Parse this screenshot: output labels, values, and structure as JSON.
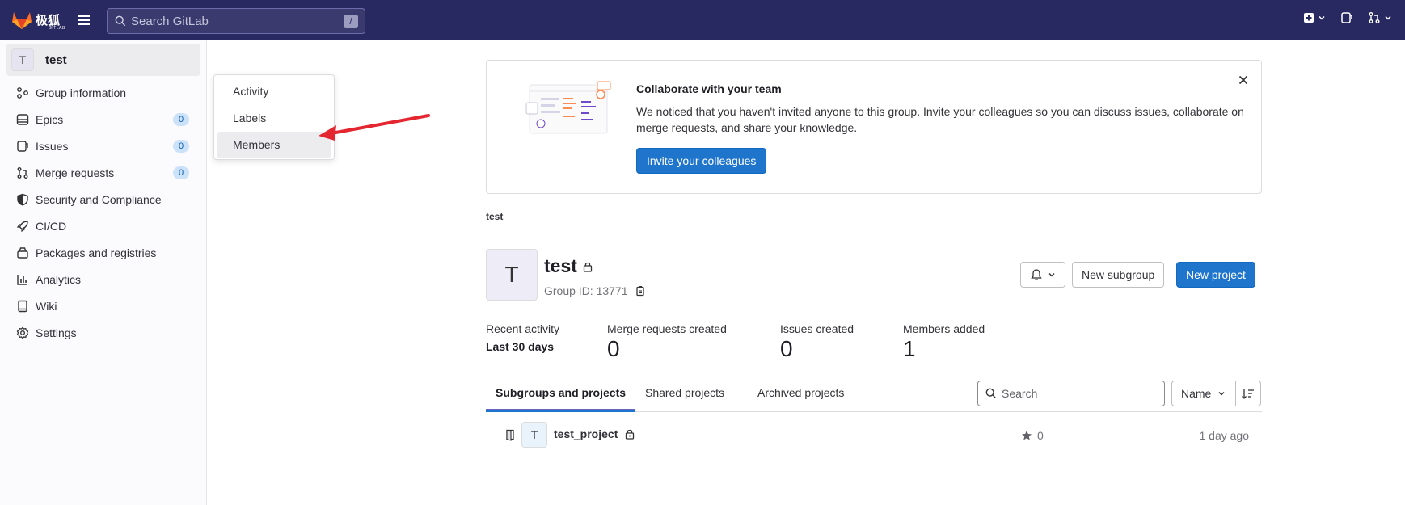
{
  "topbar": {
    "logo_text": "极狐",
    "logo_sub": "GITLAB",
    "search_placeholder": "Search GitLab",
    "search_key": "/"
  },
  "sidebar": {
    "context_avatar": "T",
    "context_name": "test",
    "items": [
      {
        "label": "Group information",
        "icon": "group-info-icon"
      },
      {
        "label": "Epics",
        "icon": "epics-icon",
        "badge": "0"
      },
      {
        "label": "Issues",
        "icon": "issues-icon",
        "badge": "0"
      },
      {
        "label": "Merge requests",
        "icon": "merge-request-icon",
        "badge": "0"
      },
      {
        "label": "Security and Compliance",
        "icon": "shield-icon"
      },
      {
        "label": "CI/CD",
        "icon": "rocket-icon"
      },
      {
        "label": "Packages and registries",
        "icon": "package-icon"
      },
      {
        "label": "Analytics",
        "icon": "chart-icon"
      },
      {
        "label": "Wiki",
        "icon": "book-icon"
      },
      {
        "label": "Settings",
        "icon": "gear-icon"
      }
    ]
  },
  "flyout": {
    "items": [
      "Activity",
      "Labels",
      "Members"
    ],
    "active": "Members"
  },
  "banner": {
    "title": "Collaborate with your team",
    "text": "We noticed that you haven't invited anyone to this group. Invite your colleagues so you can discuss issues, collaborate on merge requests, and share your knowledge.",
    "button": "Invite your colleagues"
  },
  "breadcrumb": "test",
  "group": {
    "avatar": "T",
    "name": "test",
    "id_label": "Group ID: 13771"
  },
  "actions": {
    "new_subgroup": "New subgroup",
    "new_project": "New project"
  },
  "stats": {
    "recent_label": "Recent activity",
    "recent_period": "Last 30 days",
    "items": [
      {
        "label": "Merge requests created",
        "value": "0"
      },
      {
        "label": "Issues created",
        "value": "0"
      },
      {
        "label": "Members added",
        "value": "1"
      }
    ]
  },
  "tabs": [
    "Subgroups and projects",
    "Shared projects",
    "Archived projects"
  ],
  "filter": {
    "search_placeholder": "Search",
    "sort_label": "Name"
  },
  "projects": [
    {
      "avatar": "T",
      "name": "test_project",
      "stars": "0",
      "updated": "1 day ago"
    }
  ],
  "colors": {
    "topbar": "#292961",
    "primary": "#1f75cb",
    "arrow": "#e3262f"
  }
}
